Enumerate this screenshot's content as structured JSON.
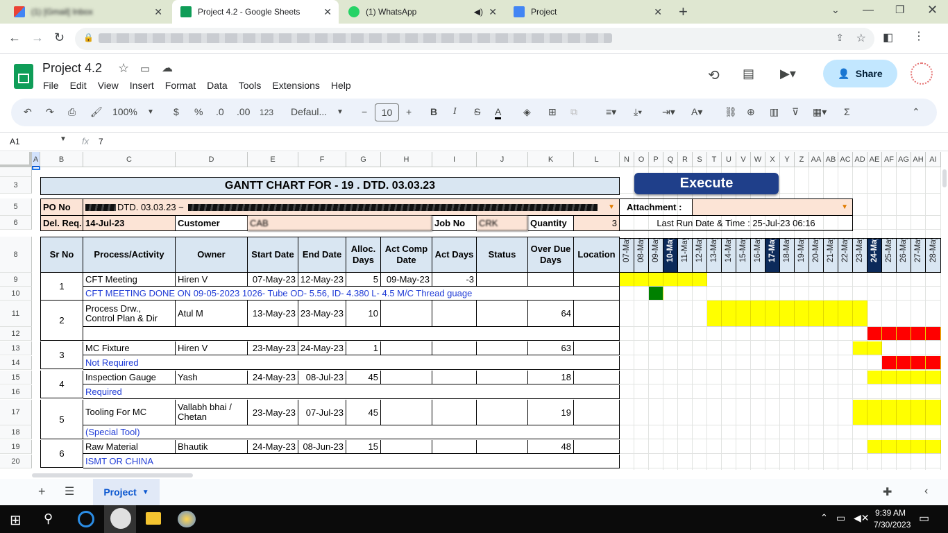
{
  "browser": {
    "tabs": [
      {
        "label": "(1) [Gmail] Inbox",
        "icon": "gmail-icon"
      },
      {
        "label": "Project 4.2 - Google Sheets",
        "icon": "sheets-icon"
      },
      {
        "label": "(1) WhatsApp",
        "icon": "whatsapp-icon"
      },
      {
        "label": "Project",
        "icon": "docs-icon"
      }
    ],
    "url": "https://docs.google.com/spreadsheets/d/"
  },
  "app": {
    "title": "Project 4.2",
    "share": "Share",
    "menus": [
      "File",
      "Edit",
      "View",
      "Insert",
      "Format",
      "Data",
      "Tools",
      "Extensions",
      "Help"
    ]
  },
  "toolbar": {
    "zoom": "100%",
    "currency": "$",
    "percent": "%",
    "dec_less": ".0",
    "dec_more": ".00",
    "numfmt": "123",
    "font": "Defaul...",
    "size": "10"
  },
  "formula": {
    "cellref": "A1",
    "fx": "fx",
    "value": "7"
  },
  "cols": [
    "A",
    "B",
    "C",
    "D",
    "E",
    "F",
    "G",
    "H",
    "I",
    "J",
    "K",
    "L",
    "N",
    "O",
    "P",
    "Q",
    "R",
    "S",
    "T",
    "U",
    "V",
    "W",
    "X",
    "Y",
    "Z",
    "AA",
    "AB",
    "AC",
    "AD",
    "AE",
    "AF",
    "AG",
    "AH",
    "AI"
  ],
  "rows": [
    "3",
    "5",
    "6",
    "8",
    "9",
    "10",
    "11",
    "12",
    "13",
    "14",
    "15",
    "16",
    "17",
    "18",
    "19",
    "20"
  ],
  "sheet": {
    "title": "GANTT CHART FOR - 19 . DTD. 03.03.23",
    "execute": "Execute",
    "po_label": "PO No",
    "po_value": "DTD. 03.03.23 ~",
    "attach_label": "Attachment :",
    "delreq_label": "Del. Req.",
    "delreq_value": "14-Jul-23",
    "customer_label": "Customer",
    "customer_value": "CAB",
    "job_label": "Job No",
    "job_value": "CRK",
    "qty_label": "Quantity",
    "qty_value": "3",
    "lastrun": "Last Run Date & Time : 25-Jul-23 06:16",
    "headers": [
      "Sr No",
      "Process/Activity",
      "Owner",
      "Start Date",
      "End Date",
      "Alloc. Days",
      "Act Comp Date",
      "Act Days",
      "Status",
      "Over Due Days",
      "Location"
    ],
    "dates": [
      "07-May",
      "08-May",
      "09-May",
      "10-May",
      "11-May",
      "12-May",
      "13-May",
      "14-May",
      "15-May",
      "16-May",
      "17-May",
      "18-May",
      "19-May",
      "20-May",
      "21-May",
      "22-May",
      "23-May",
      "24-May",
      "25-May",
      "26-May",
      "27-May",
      "28-May"
    ],
    "tasks": [
      {
        "sr": "1",
        "act": "CFT Meeting",
        "owner": "Hiren V",
        "start": "07-May-23",
        "end": "12-May-23",
        "alloc": "5",
        "comp": "09-May-23",
        "actdays": "-3",
        "overdue": "",
        "note": "CFT MEETING DONE ON 09-05-2023 1026- Tube OD- 5.56, ID- 4.380 L- 4.5 M/C Thread guage"
      },
      {
        "sr": "2",
        "act": "Process Drw.,\nControl Plan & Dir",
        "owner": "Atul M",
        "start": "13-May-23",
        "end": "23-May-23",
        "alloc": "10",
        "comp": "",
        "actdays": "",
        "overdue": "64",
        "note": ""
      },
      {
        "sr": "3",
        "act": "MC Fixture",
        "owner": "Hiren V",
        "start": "23-May-23",
        "end": "24-May-23",
        "alloc": "1",
        "comp": "",
        "actdays": "",
        "overdue": "63",
        "note": "Not Required"
      },
      {
        "sr": "4",
        "act": "Inspection Gauge",
        "owner": "Yash",
        "start": "24-May-23",
        "end": "08-Jul-23",
        "alloc": "45",
        "comp": "",
        "actdays": "",
        "overdue": "18",
        "note": "Required"
      },
      {
        "sr": "5",
        "act": "Tooling For MC",
        "owner": "Vallabh bhai /\nChetan",
        "start": "23-May-23",
        "end": "07-Jul-23",
        "alloc": "45",
        "comp": "",
        "actdays": "",
        "overdue": "19",
        "note": "(Special Tool)"
      },
      {
        "sr": "6",
        "act": "Raw Material",
        "owner": "Bhautik",
        "start": "24-May-23",
        "end": "08-Jun-23",
        "alloc": "15",
        "comp": "",
        "actdays": "",
        "overdue": "48",
        "note": "ISMT OR CHINA"
      }
    ],
    "sheet_tab": "Project"
  },
  "taskbar": {
    "time": "9:39 AM",
    "date": "7/30/2023"
  },
  "colors": {
    "yellow": "#ffff00",
    "red": "#ff0000",
    "green": "#008000",
    "header": "#d9e6f2",
    "peach": "#fce4d6",
    "execute": "#1f3f8a"
  }
}
